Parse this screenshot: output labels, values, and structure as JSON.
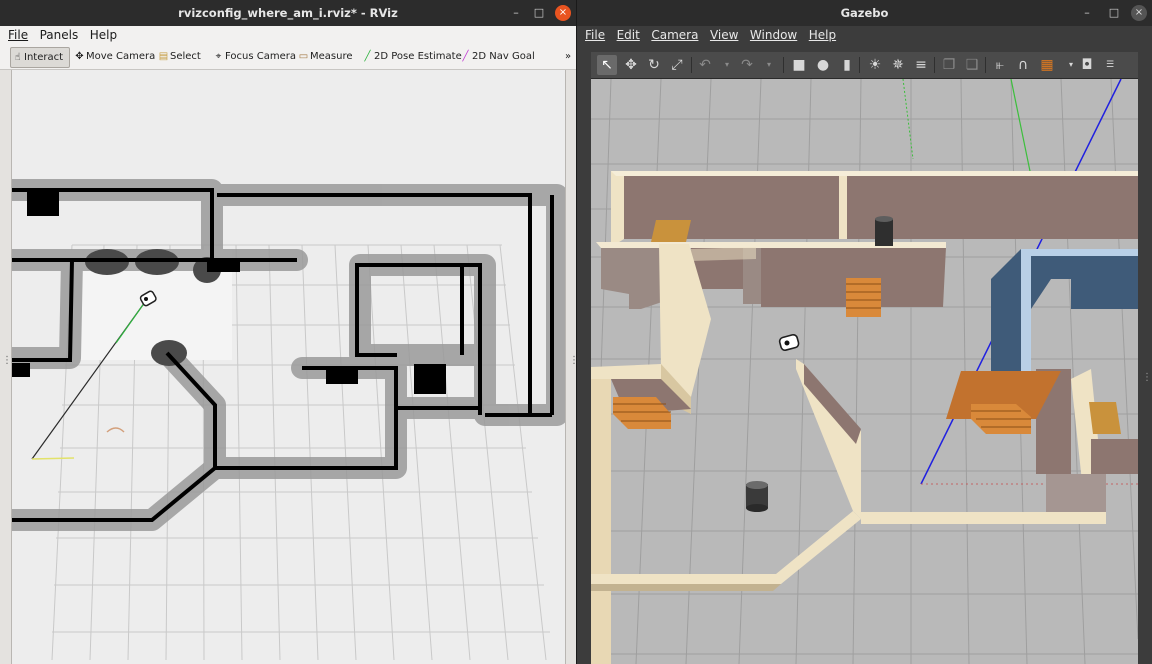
{
  "rviz": {
    "title": "rvizconfig_where_am_i.rviz* - RViz",
    "controls": {
      "minimize": "–",
      "maximize": "□",
      "close": "×"
    },
    "menu": [
      "File",
      "Panels",
      "Help"
    ],
    "tools": [
      {
        "label": "Interact",
        "icon": "cursor-icon",
        "active": true
      },
      {
        "label": "Move Camera",
        "icon": "move-camera-icon"
      },
      {
        "label": "Select",
        "icon": "select-icon"
      },
      {
        "label": "Focus Camera",
        "icon": "focus-camera-icon"
      },
      {
        "label": "Measure",
        "icon": "measure-icon"
      },
      {
        "label": "2D Pose Estimate",
        "icon": "pose-arrow-icon",
        "color": "#2fb33f"
      },
      {
        "label": "2D Nav Goal",
        "icon": "nav-goal-arrow-icon",
        "color": "#c23bd4"
      }
    ],
    "toolbar_overflow": "»",
    "splitter_handle": "⋮"
  },
  "gazebo": {
    "title": "Gazebo",
    "controls": {
      "minimize": "–",
      "maximize": "□",
      "close": "×"
    },
    "menu": [
      "File",
      "Edit",
      "Camera",
      "View",
      "Window",
      "Help"
    ],
    "toolbar_icons": [
      "select-arrow-icon",
      "translate-icon",
      "rotate-icon",
      "scale-icon",
      "undo-icon",
      "undo-dropdown-icon",
      "redo-icon",
      "redo-dropdown-icon",
      "box-icon",
      "sphere-icon",
      "cylinder-icon",
      "point-light-icon",
      "spot-light-icon",
      "directional-light-icon",
      "copy-icon",
      "paste-icon",
      "align-icon",
      "snap-icon",
      "change-view-icon",
      "screenshot-icon",
      "log-icon"
    ],
    "splitter_handle": "⋮"
  },
  "colors": {
    "rviz_accent": "#e95420",
    "map_wall": "#000000",
    "costmap_inflation": "#888888",
    "pose_estimate_green": "#2fb33f",
    "nav_goal_purple": "#c23bd4",
    "gazebo_wall_cream": "#efe3c5",
    "gazebo_wall_blue": "#3f5b79",
    "gazebo_floor": "#b9b9b9"
  }
}
